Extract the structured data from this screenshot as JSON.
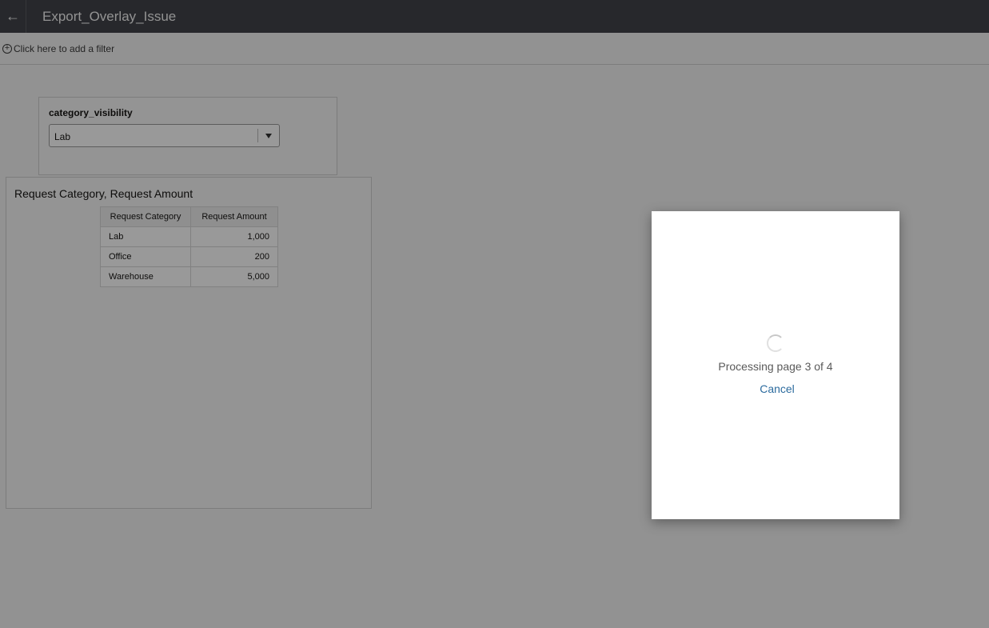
{
  "header": {
    "back_icon": "←",
    "title": "Export_Overlay_Issue"
  },
  "filter_bar": {
    "add_icon": "+",
    "add_filter_label": "Click here to add a filter"
  },
  "parameter": {
    "label": "category_visibility",
    "selected_value": "Lab"
  },
  "visualization": {
    "title": "Request Category, Request Amount",
    "columns": [
      "Request Category",
      "Request Amount"
    ],
    "rows": [
      {
        "category": "Lab",
        "amount": "1,000"
      },
      {
        "category": "Office",
        "amount": "200"
      },
      {
        "category": "Warehouse",
        "amount": "5,000"
      }
    ]
  },
  "dialog": {
    "progress_text": "Processing page 3 of 4",
    "cancel_label": "Cancel"
  },
  "colors": {
    "header_bg": "#41434a",
    "link": "#2c6b9e",
    "overlay": "rgba(0,0,0,0.4)"
  }
}
